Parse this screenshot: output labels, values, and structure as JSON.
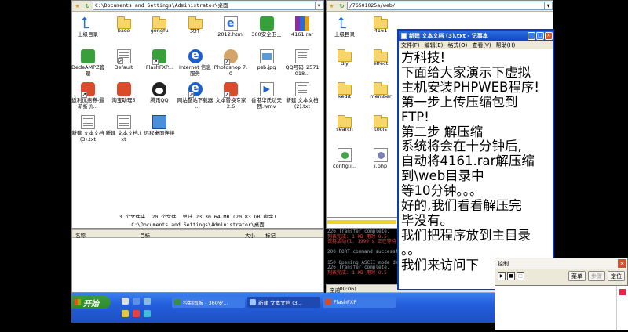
{
  "left_pane": {
    "path": "C:\\Documents and Settings\\Administrator\\桌面",
    "items": [
      {
        "label": "上级目录",
        "icon": "up-arrow-icon"
      },
      {
        "label": "base",
        "icon": "folder-icon"
      },
      {
        "label": "gongfu",
        "icon": "folder-icon"
      },
      {
        "label": "文件",
        "icon": "folder-icon"
      },
      {
        "label": "2012.html",
        "icon": "html-file-icon"
      },
      {
        "label": "360安全卫士",
        "icon": "shield-app-icon"
      },
      {
        "label": "4161.rar",
        "icon": "rar-archive-icon"
      },
      {
        "label": "DedeAMPZ管理",
        "icon": "server-app-icon"
      },
      {
        "label": "Default",
        "icon": "shortcut-file-icon"
      },
      {
        "label": "FlashFXP...",
        "icon": "ftp-app-icon"
      },
      {
        "label": "Internet 信息服务",
        "icon": "ie-icon"
      },
      {
        "label": "Photoshop 7.0",
        "icon": "photoshop-icon"
      },
      {
        "label": "psb.jpg",
        "icon": "image-file-icon"
      },
      {
        "label": "QQ号码_2571018...",
        "icon": "text-file-icon"
      },
      {
        "label": "返利优惠券-最新折价...",
        "icon": "app-shortcut-icon"
      },
      {
        "label": "淘宝助理5",
        "icon": "taobao-icon"
      },
      {
        "label": "腾讯QQ",
        "icon": "qq-icon"
      },
      {
        "label": "网站整站下载器一...",
        "icon": "downloader-icon"
      },
      {
        "label": "文本替换专家 2.6",
        "icon": "text-replace-icon"
      },
      {
        "label": "香港华氏功夫团.wmv",
        "icon": "video-file-icon"
      },
      {
        "label": "新建 文本文档 (2).txt",
        "icon": "text-file-icon"
      },
      {
        "label": "新建 文本文档 (3).txt",
        "icon": "text-file-icon"
      },
      {
        "label": "新建 文本文档.txt",
        "icon": "text-file-icon"
      },
      {
        "label": "远程桌面连接",
        "icon": "remote-desktop-icon"
      }
    ],
    "summary": "3 个文件夹, 20 个文件, 总计 23 30.64 MB (20.83 GB 剩余)",
    "status_path": "C:\\Documents and Settings\\Administrator\\桌面",
    "columns": [
      "名称",
      "目标",
      "大小",
      "标记"
    ]
  },
  "right_pane": {
    "path": "/76501025a/web/",
    "items": [
      {
        "label": "上级目录",
        "icon": "up-arrow-icon"
      },
      {
        "label": "4161",
        "icon": "folder-icon"
      },
      {
        "label": "diy",
        "icon": "folder-icon"
      },
      {
        "label": "effect",
        "icon": "folder-icon"
      },
      {
        "label": "kedit",
        "icon": "folder-icon"
      },
      {
        "label": "member",
        "icon": "folder-icon"
      },
      {
        "label": "search",
        "icon": "folder-icon"
      },
      {
        "label": "tools",
        "icon": "folder-icon"
      },
      {
        "label": "config.i...",
        "icon": "config-file-icon"
      },
      {
        "label": "i.php",
        "icon": "php-file-icon"
      }
    ],
    "log": [
      {
        "text": "226 Transfer complete.",
        "color": "#9aa7b0"
      },
      {
        "text": "列表完成: 1 KB 用时 0.5",
        "color": "#ff3b3b"
      },
      {
        "text": "保持活动(1. 1999 s 正在等待",
        "color": "#e04040"
      },
      {
        "text": "",
        "color": "#9aa7b0"
      },
      {
        "text": "200 PORT command successful",
        "color": "#9aa7b0"
      },
      {
        "text": "",
        "color": "#9aa7b0"
      },
      {
        "text": "150 Opening ASCII mode data",
        "color": "#9aa7b0"
      },
      {
        "text": "226 Transfer complete.",
        "color": "#9aa7b0"
      },
      {
        "text": "列表完成: 1 KB 用时 0.5",
        "color": "#ff3b3b"
      }
    ],
    "idle_label": "空闲",
    "idle_time": "(00:06)"
  },
  "notepad": {
    "title": "新建 文本文档 (3).txt - 记事本",
    "menu": [
      "文件(F)",
      "编辑(E)",
      "格式(O)",
      "查看(V)",
      "帮助(H)"
    ],
    "lines": [
      "方科技!",
      "下面给大家演示下虚拟",
      "主机安装PHPWEB程序!",
      "第一步上传压缩包到",
      "FTP!",
      "第二步  解压缩",
      "系统将会在十分钟后,",
      "自动将4161.rar解压缩",
      "到\\web目录中",
      "等10分钟。。。",
      "好的,我们看看解压完",
      "毕没有。",
      "我们把程序放到主目录",
      "。。",
      "我们来访问下"
    ]
  },
  "control": {
    "title": "控制",
    "buttons": [
      "菜单",
      "步骤",
      "定位"
    ]
  },
  "taskbar": {
    "start_label": "开始",
    "tasks": [
      {
        "label": "控制面板 - 360安...",
        "color": "#3c8d3c"
      },
      {
        "label": "新建 文本文档 (3...",
        "color": "#9fc3ff"
      },
      {
        "label": "FlashFXP",
        "color": "#d74a2a"
      }
    ]
  }
}
